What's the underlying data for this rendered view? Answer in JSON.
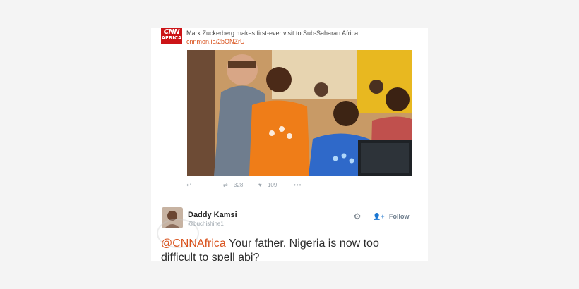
{
  "source_tweet": {
    "logo_text_top": "CNN",
    "logo_text_bottom": "AFRICA",
    "headline": "Mark Zuckerberg makes first-ever visit to Sub-Saharan Africa:",
    "link": "cnnmon.ie/2bONZrU",
    "retweet_count": "328",
    "like_count": "109"
  },
  "reply_tweet": {
    "display_name": "Daddy Kamsi",
    "handle": "@buchishine1",
    "follow_label": "Follow",
    "mention": "@CNNAfrica",
    "text_line1": " Your father. Nigeria is now too",
    "text_line2": "difficult to spell abi?"
  },
  "colors": {
    "accent": "#d9531e",
    "cnn_red": "#cc1417",
    "follow_icon": "#4b90d6",
    "muted": "#9aa3ab"
  }
}
